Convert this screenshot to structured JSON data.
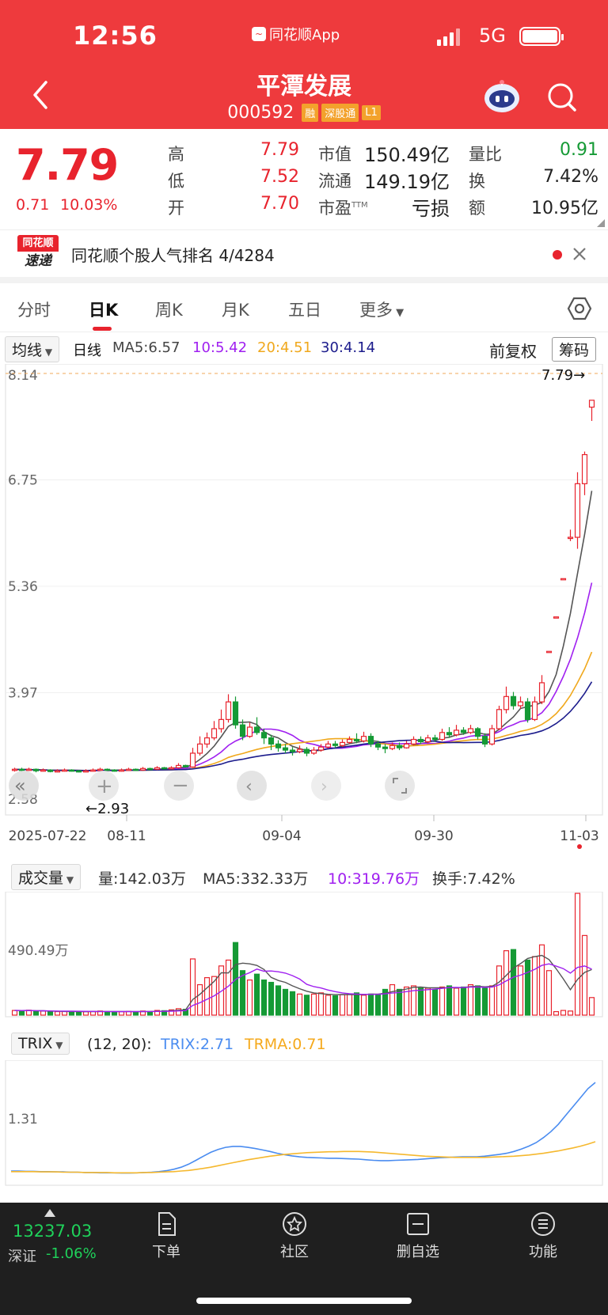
{
  "status": {
    "time": "12:56",
    "app": "同花顺App",
    "network": "5G"
  },
  "header": {
    "title": "平潭发展",
    "code": "000592",
    "tags": [
      "融",
      "深股通",
      "L1"
    ]
  },
  "quote": {
    "price": "7.79",
    "change": "0.71",
    "change_pct": "10.03%",
    "rows": [
      [
        {
          "l": "高",
          "v": "7.79"
        },
        {
          "l": "市值",
          "v": "150.49亿"
        },
        {
          "l": "量比",
          "v": "0.91"
        }
      ],
      [
        {
          "l": "低",
          "v": "7.52"
        },
        {
          "l": "流通",
          "v": "149.19亿"
        },
        {
          "l": "换",
          "v": "7.42%"
        }
      ],
      [
        {
          "l": "开",
          "v": "7.70"
        },
        {
          "l": "市盈",
          "sup": "TTM",
          "v": "亏损"
        },
        {
          "l": "额",
          "v": "10.95亿"
        }
      ]
    ]
  },
  "rank": {
    "logo_top": "同花顺",
    "logo_bottom": "速递",
    "text": "同花顺个股人气排名 4/4284"
  },
  "tabs": [
    "分时",
    "日K",
    "周K",
    "月K",
    "五日",
    "更多"
  ],
  "ma_bar": {
    "dropdown": "均线",
    "period": "日线",
    "ma5": "MA5:6.57",
    "ma10": "10:5.42",
    "ma20": "20:4.51",
    "ma30": "30:4.14",
    "adjust": "前复权",
    "chips": "筹码"
  },
  "kline": {
    "y_ticks": [
      "8.14",
      "6.75",
      "5.36",
      "3.97",
      "2.58"
    ],
    "last_price_label": "7.79→",
    "low_label": "←2.93",
    "x_ticks": [
      "2025-07-22",
      "08-11",
      "09-04",
      "09-30",
      "11-03"
    ]
  },
  "volume_bar": {
    "dropdown": "成交量",
    "vol": "量:142.03万",
    "ma5": "MA5:332.33万",
    "ma10": "10:319.76万",
    "turnover": "换手:7.42%",
    "y_tick": "490.49万"
  },
  "trix_bar": {
    "dropdown": "TRIX",
    "params": "(12, 20):",
    "trix": "TRIX:2.71",
    "trma": "TRMA:0.71",
    "y_tick": "1.31"
  },
  "colors": {
    "up": "#e8232d",
    "down": "#159a35",
    "ma5": "#555555",
    "ma10": "#a020f0",
    "ma20": "#f0a81c",
    "ma30": "#1c1c8c",
    "trix": "#4a8cf0",
    "trma": "#f5b82e"
  },
  "bottom": {
    "index_value": "13237.03",
    "index_name": "深证",
    "index_pct": "-1.06%",
    "nav": [
      "下单",
      "社区",
      "删自选",
      "功能"
    ]
  },
  "chart_data": {
    "type": "candlestick",
    "ylim": [
      2.58,
      8.14
    ],
    "candles": [
      [
        2.96,
        2.97,
        2.99,
        2.94
      ],
      [
        2.97,
        2.96,
        2.99,
        2.94
      ],
      [
        2.96,
        2.97,
        2.99,
        2.95
      ],
      [
        2.97,
        2.95,
        2.98,
        2.93
      ],
      [
        2.95,
        2.96,
        2.98,
        2.94
      ],
      [
        2.96,
        2.94,
        2.97,
        2.93
      ],
      [
        2.94,
        2.95,
        2.97,
        2.93
      ],
      [
        2.95,
        2.96,
        2.98,
        2.94
      ],
      [
        2.96,
        2.95,
        2.97,
        2.94
      ],
      [
        2.95,
        2.94,
        2.96,
        2.93
      ],
      [
        2.94,
        2.95,
        2.97,
        2.93
      ],
      [
        2.95,
        2.96,
        2.98,
        2.94
      ],
      [
        2.96,
        2.97,
        2.99,
        2.95
      ],
      [
        2.97,
        2.96,
        2.98,
        2.95
      ],
      [
        2.96,
        2.95,
        2.97,
        2.94
      ],
      [
        2.95,
        2.96,
        2.98,
        2.94
      ],
      [
        2.96,
        2.97,
        2.99,
        2.95
      ],
      [
        2.97,
        2.96,
        2.98,
        2.95
      ],
      [
        2.96,
        2.98,
        3.0,
        2.95
      ],
      [
        2.98,
        2.97,
        2.99,
        2.96
      ],
      [
        2.97,
        2.99,
        3.01,
        2.96
      ],
      [
        2.99,
        2.98,
        3.0,
        2.97
      ],
      [
        2.98,
        2.99,
        3.01,
        2.97
      ],
      [
        2.99,
        3.02,
        3.05,
        2.98
      ],
      [
        3.02,
        3.0,
        3.03,
        2.99
      ],
      [
        3.0,
        3.18,
        3.25,
        2.99
      ],
      [
        3.18,
        3.3,
        3.4,
        3.15
      ],
      [
        3.3,
        3.38,
        3.45,
        3.25
      ],
      [
        3.38,
        3.5,
        3.6,
        3.35
      ],
      [
        3.5,
        3.62,
        3.75,
        3.45
      ],
      [
        3.62,
        3.85,
        3.95,
        3.58
      ],
      [
        3.85,
        3.55,
        3.92,
        3.5
      ],
      [
        3.55,
        3.4,
        3.62,
        3.35
      ],
      [
        3.4,
        3.52,
        3.58,
        3.38
      ],
      [
        3.52,
        3.45,
        3.65,
        3.42
      ],
      [
        3.45,
        3.38,
        3.5,
        3.3
      ],
      [
        3.38,
        3.3,
        3.42,
        3.22
      ],
      [
        3.3,
        3.25,
        3.35,
        3.2
      ],
      [
        3.25,
        3.22,
        3.3,
        3.18
      ],
      [
        3.22,
        3.2,
        3.26,
        3.15
      ],
      [
        3.2,
        3.23,
        3.28,
        3.18
      ],
      [
        3.23,
        3.18,
        3.26,
        3.14
      ],
      [
        3.18,
        3.22,
        3.26,
        3.16
      ],
      [
        3.22,
        3.26,
        3.3,
        3.2
      ],
      [
        3.26,
        3.3,
        3.34,
        3.24
      ],
      [
        3.3,
        3.28,
        3.34,
        3.25
      ],
      [
        3.28,
        3.32,
        3.36,
        3.26
      ],
      [
        3.32,
        3.36,
        3.4,
        3.3
      ],
      [
        3.36,
        3.34,
        3.44,
        3.31
      ],
      [
        3.34,
        3.4,
        3.46,
        3.32
      ],
      [
        3.4,
        3.3,
        3.44,
        3.26
      ],
      [
        3.3,
        3.26,
        3.34,
        3.22
      ],
      [
        3.26,
        3.24,
        3.3,
        3.18
      ],
      [
        3.24,
        3.28,
        3.32,
        3.22
      ],
      [
        3.28,
        3.25,
        3.32,
        3.22
      ],
      [
        3.25,
        3.3,
        3.34,
        3.24
      ],
      [
        3.3,
        3.36,
        3.4,
        3.28
      ],
      [
        3.36,
        3.33,
        3.4,
        3.3
      ],
      [
        3.33,
        3.38,
        3.42,
        3.31
      ],
      [
        3.38,
        3.36,
        3.42,
        3.33
      ],
      [
        3.36,
        3.45,
        3.5,
        3.34
      ],
      [
        3.45,
        3.42,
        3.52,
        3.38
      ],
      [
        3.42,
        3.48,
        3.55,
        3.4
      ],
      [
        3.48,
        3.45,
        3.52,
        3.42
      ],
      [
        3.45,
        3.5,
        3.55,
        3.43
      ],
      [
        3.5,
        3.4,
        3.52,
        3.36
      ],
      [
        3.4,
        3.3,
        3.44,
        3.26
      ],
      [
        3.3,
        3.5,
        3.55,
        3.28
      ],
      [
        3.5,
        3.75,
        3.8,
        3.48
      ],
      [
        3.75,
        3.92,
        4.05,
        3.7
      ],
      [
        3.92,
        3.8,
        3.98,
        3.75
      ],
      [
        3.8,
        3.85,
        3.92,
        3.76
      ],
      [
        3.85,
        3.62,
        3.9,
        3.58
      ],
      [
        3.62,
        3.85,
        3.92,
        3.6
      ],
      [
        3.85,
        4.1,
        4.2,
        3.82
      ],
      [
        4.51,
        4.51,
        4.51,
        4.51
      ],
      [
        4.96,
        4.96,
        4.96,
        4.96
      ],
      [
        5.46,
        5.46,
        5.46,
        5.46
      ],
      [
        6.0,
        6.0,
        6.1,
        5.95
      ],
      [
        6.0,
        6.7,
        6.85,
        5.85
      ],
      [
        6.7,
        7.08,
        7.12,
        6.55
      ],
      [
        7.7,
        7.79,
        7.79,
        7.52
      ]
    ],
    "volume_ylim": [
      0,
      1000
    ],
    "volume": [
      40,
      38,
      42,
      30,
      35,
      28,
      30,
      32,
      30,
      28,
      30,
      32,
      35,
      30,
      28,
      30,
      32,
      28,
      35,
      30,
      40,
      38,
      45,
      55,
      50,
      480,
      260,
      320,
      330,
      420,
      470,
      620,
      380,
      300,
      350,
      300,
      280,
      250,
      220,
      200,
      180,
      170,
      180,
      190,
      170,
      165,
      175,
      180,
      190,
      170,
      180,
      175,
      220,
      260,
      220,
      240,
      250,
      230,
      230,
      220,
      240,
      250,
      230,
      240,
      260,
      250,
      230,
      250,
      420,
      550,
      560,
      420,
      470,
      500,
      600,
      380,
      30,
      40,
      35,
      1040,
      680,
      150
    ],
    "trix_ylim": [
      -0.6,
      3.3
    ],
    "trix": [
      -0.28,
      -0.28,
      -0.29,
      -0.29,
      -0.3,
      -0.3,
      -0.31,
      -0.31,
      -0.32,
      -0.32,
      -0.33,
      -0.33,
      -0.34,
      -0.34,
      -0.34,
      -0.35,
      -0.35,
      -0.34,
      -0.33,
      -0.32,
      -0.3,
      -0.27,
      -0.22,
      -0.15,
      -0.05,
      0.08,
      0.22,
      0.35,
      0.45,
      0.52,
      0.55,
      0.55,
      0.52,
      0.48,
      0.43,
      0.38,
      0.32,
      0.27,
      0.23,
      0.2,
      0.18,
      0.17,
      0.16,
      0.15,
      0.15,
      0.14,
      0.13,
      0.12,
      0.1,
      0.08,
      0.07,
      0.07,
      0.08,
      0.09,
      0.1,
      0.11,
      0.13,
      0.15,
      0.17,
      0.18,
      0.19,
      0.2,
      0.2,
      0.2,
      0.22,
      0.25,
      0.28,
      0.32,
      0.38,
      0.46,
      0.56,
      0.68,
      0.85,
      1.05,
      1.3,
      1.6,
      1.9,
      2.2,
      2.5,
      2.71
    ],
    "trma": [
      -0.3,
      -0.3,
      -0.3,
      -0.3,
      -0.31,
      -0.31,
      -0.31,
      -0.32,
      -0.32,
      -0.32,
      -0.33,
      -0.33,
      -0.33,
      -0.33,
      -0.34,
      -0.34,
      -0.34,
      -0.34,
      -0.33,
      -0.33,
      -0.32,
      -0.31,
      -0.3,
      -0.28,
      -0.26,
      -0.23,
      -0.19,
      -0.15,
      -0.1,
      -0.05,
      0.0,
      0.05,
      0.1,
      0.14,
      0.18,
      0.22,
      0.25,
      0.28,
      0.3,
      0.32,
      0.34,
      0.35,
      0.36,
      0.37,
      0.37,
      0.38,
      0.38,
      0.38,
      0.37,
      0.36,
      0.34,
      0.32,
      0.3,
      0.28,
      0.26,
      0.24,
      0.22,
      0.21,
      0.2,
      0.19,
      0.18,
      0.18,
      0.18,
      0.18,
      0.18,
      0.19,
      0.2,
      0.21,
      0.22,
      0.24,
      0.26,
      0.29,
      0.32,
      0.36,
      0.4,
      0.45,
      0.5,
      0.56,
      0.63,
      0.71
    ]
  }
}
